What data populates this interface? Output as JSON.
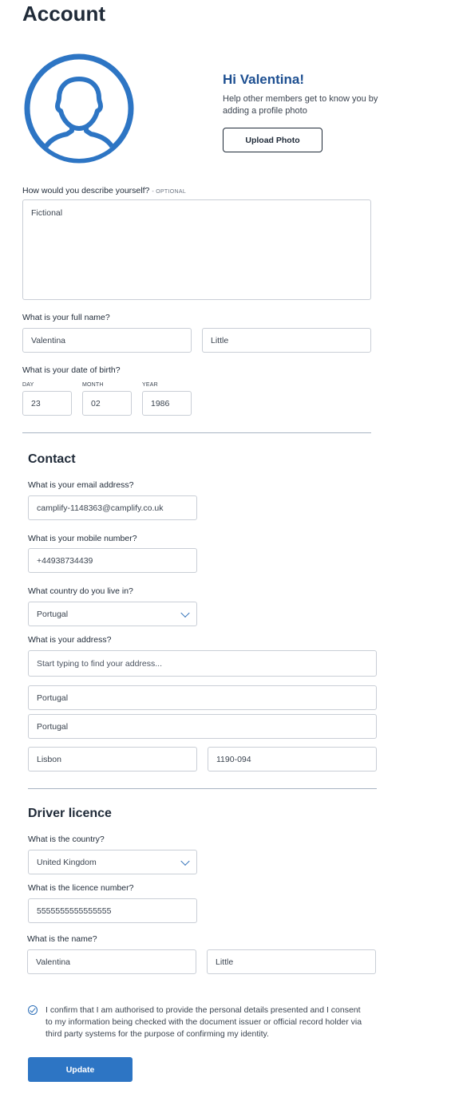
{
  "page": {
    "title": "Account"
  },
  "profile": {
    "greeting": "Hi Valentina!",
    "help_text": "Help other members get to know you by adding a profile photo",
    "upload_label": "Upload Photo",
    "avatar_icon": "user-avatar-icon",
    "accent": "#2d75c4"
  },
  "describe": {
    "label": "How would you describe yourself?",
    "optional": "- OPTIONAL",
    "value": "Fictional"
  },
  "full_name": {
    "label": "What is your full name?",
    "first": "Valentina",
    "last": "Little"
  },
  "dob": {
    "label": "What is your date of birth?",
    "day_label": "DAY",
    "month_label": "MONTH",
    "year_label": "YEAR",
    "day": "23",
    "month": "02",
    "year": "1986"
  },
  "contact": {
    "heading": "Contact",
    "email_label": "What is your email address?",
    "email": "camplify-1148363@camplify.co.uk",
    "mobile_label": "What is your mobile number?",
    "mobile": "+44938734439",
    "country_label": "What country do you live in?",
    "country": "Portugal",
    "address_label": "What is your address?",
    "address_placeholder": "Start typing to find your address...",
    "address_line1": "Portugal",
    "address_line2": "Portugal",
    "city": "Lisbon",
    "postcode": "1190-094"
  },
  "licence": {
    "heading": "Driver licence",
    "country_label": "What is the country?",
    "country": "United Kingdom",
    "number_label": "What is the licence number?",
    "number": "5555555555555555",
    "name_label": "What is the name?",
    "first": "Valentina",
    "last": "Little"
  },
  "consent": {
    "text": "I confirm that I am authorised to provide the personal details presented and I consent to my information being checked with the document issuer or official record holder via third party systems for the purpose of confirming my identity.",
    "checked": true
  },
  "actions": {
    "update_label": "Update"
  }
}
